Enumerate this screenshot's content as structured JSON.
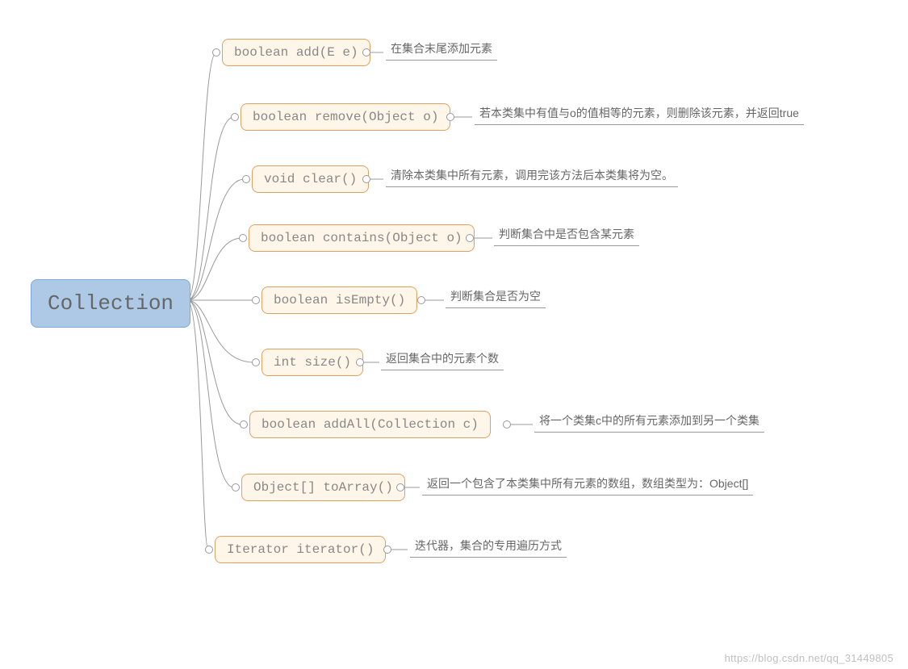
{
  "root": {
    "label": "Collection"
  },
  "methods": [
    {
      "sig": "boolean add(E e)",
      "desc": "在集合末尾添加元素"
    },
    {
      "sig": "boolean remove(Object o)",
      "desc": "若本类集中有值与o的值相等的元素，则删除该元素，并返回true"
    },
    {
      "sig": "void clear()",
      "desc": "清除本类集中所有元素，调用完该方法后本类集将为空。"
    },
    {
      "sig": "boolean contains(Object o)",
      "desc": "判断集合中是否包含某元素"
    },
    {
      "sig": "boolean isEmpty()",
      "desc": "判断集合是否为空"
    },
    {
      "sig": "int size()",
      "desc": "返回集合中的元素个数"
    },
    {
      "sig": "boolean addAll(Collection c)",
      "desc": "将一个类集c中的所有元素添加到另一个类集"
    },
    {
      "sig": "Object[] toArray()",
      "desc": "返回一个包含了本类集中所有元素的数组，数组类型为：Object[]"
    },
    {
      "sig": "Iterator iterator()",
      "desc": "迭代器，集合的专用遍历方式"
    }
  ],
  "watermark": "https://blog.csdn.net/qq_31449805"
}
